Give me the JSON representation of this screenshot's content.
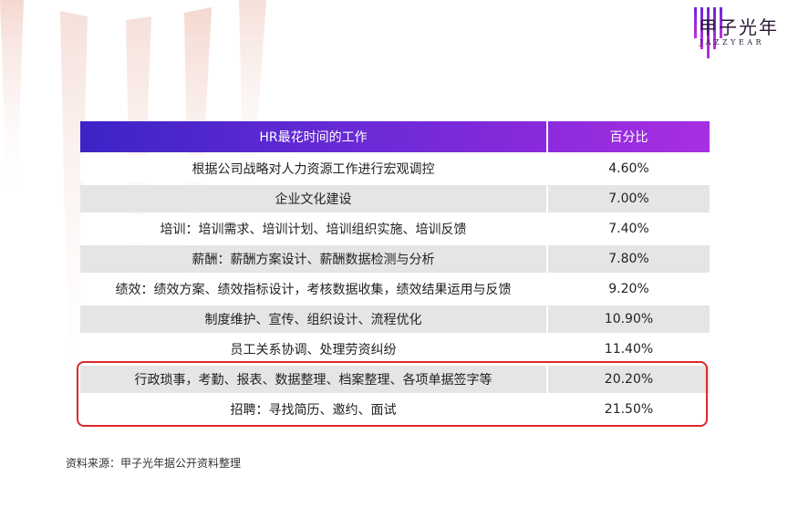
{
  "brand": {
    "name_cn": "甲子光年",
    "name_en": "JAZZYEAR"
  },
  "table": {
    "headers": [
      "HR最花时间的工作",
      "百分比"
    ],
    "rows": [
      {
        "task": "根据公司战略对人力资源工作进行宏观调控",
        "percent": "4.60%"
      },
      {
        "task": "企业文化建设",
        "percent": "7.00%"
      },
      {
        "task": "培训：培训需求、培训计划、培训组织实施、培训反馈",
        "percent": "7.40%"
      },
      {
        "task": "薪酬：薪酬方案设计、薪酬数据检测与分析",
        "percent": "7.80%"
      },
      {
        "task": "绩效：绩效方案、绩效指标设计，考核数据收集，绩效结果运用与反馈",
        "percent": "9.20%"
      },
      {
        "task": "制度维护、宣传、组织设计、流程优化",
        "percent": "10.90%"
      },
      {
        "task": "员工关系协调、处理劳资纠纷",
        "percent": "11.40%"
      },
      {
        "task": "行政琐事，考勤、报表、数据整理、档案整理、各项单据签字等",
        "percent": "20.20%"
      },
      {
        "task": "招聘：寻找简历、邀约、面试",
        "percent": "21.50%"
      }
    ]
  },
  "source": "资料来源：甲子光年据公开资料整理",
  "colors": {
    "header_start": "#3c24c6",
    "header_end": "#a82fe2",
    "highlight_border": "#e0262a",
    "stripe": "#e5e5e5"
  }
}
